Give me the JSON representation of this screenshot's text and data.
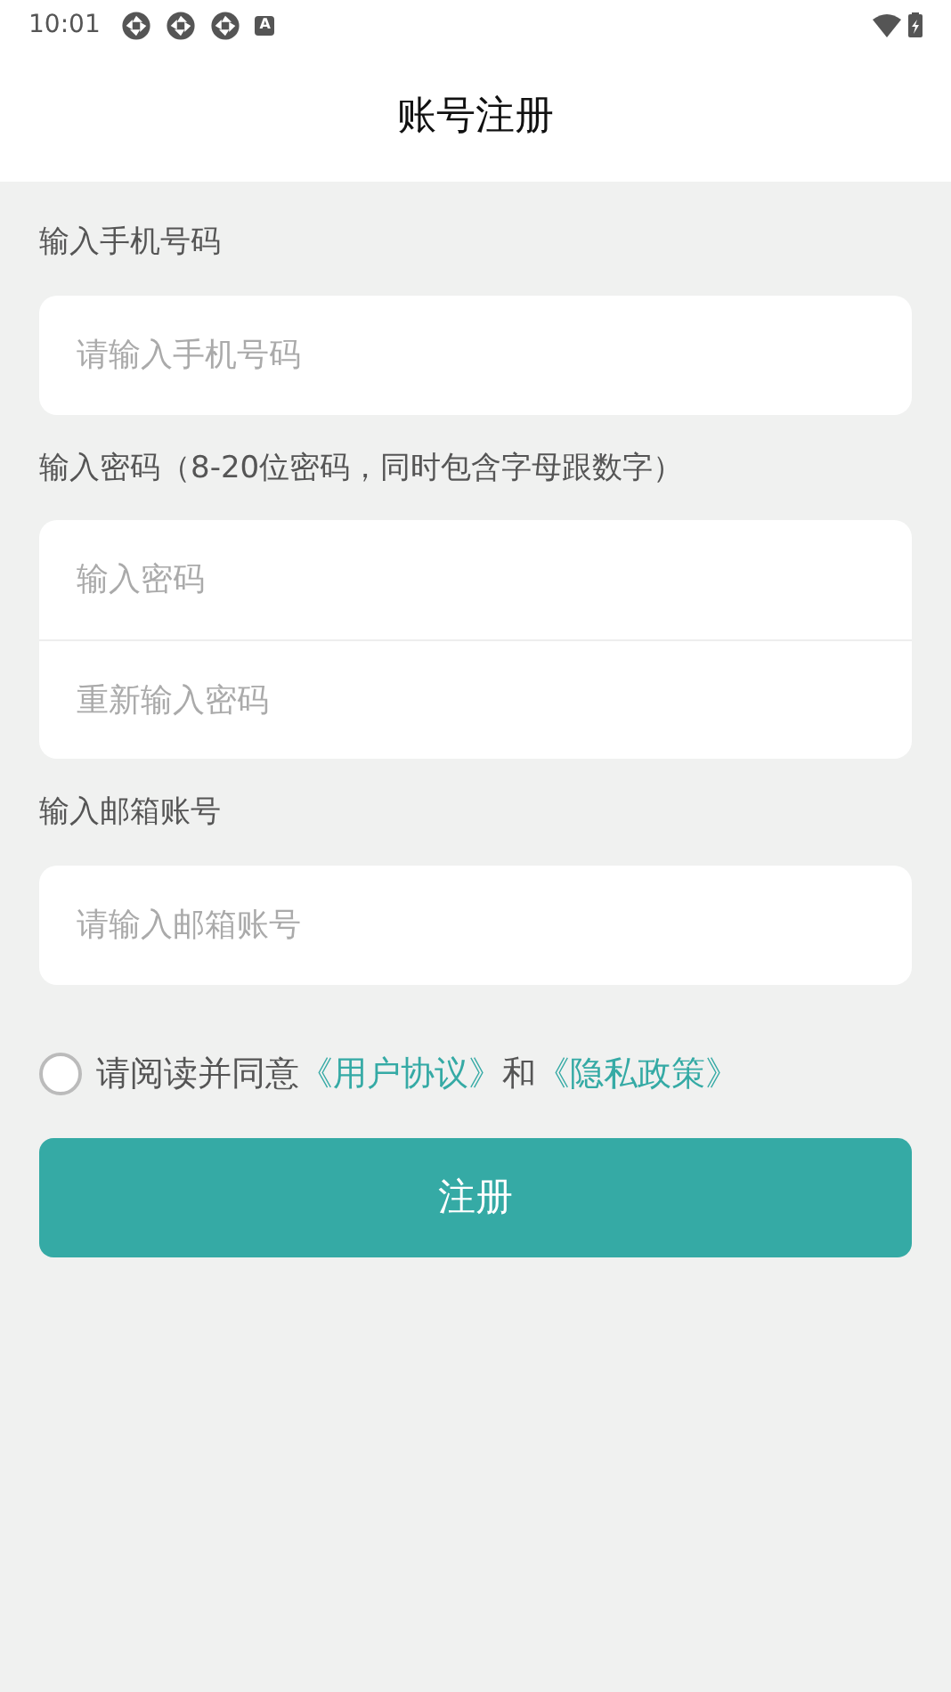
{
  "status_bar": {
    "time": "10:01",
    "notification_badge": "A"
  },
  "header": {
    "title": "账号注册"
  },
  "sections": [
    {
      "label": "输入手机号码",
      "fields": [
        {
          "placeholder": "请输入手机号码"
        }
      ]
    },
    {
      "label": "输入密码（8-20位密码，同时包含字母跟数字）",
      "fields": [
        {
          "placeholder": "输入密码"
        },
        {
          "placeholder": "重新输入密码"
        }
      ]
    },
    {
      "label": "输入邮箱账号",
      "fields": [
        {
          "placeholder": "请输入邮箱账号"
        }
      ]
    }
  ],
  "agreement": {
    "checked": false,
    "parts": [
      {
        "kind": "text",
        "text": "请阅读并同意"
      },
      {
        "kind": "link",
        "text": "《用户协议》"
      },
      {
        "kind": "text",
        "text": "和"
      },
      {
        "kind": "link",
        "text": "《隐私政策》"
      }
    ]
  },
  "submit_button": "注册"
}
